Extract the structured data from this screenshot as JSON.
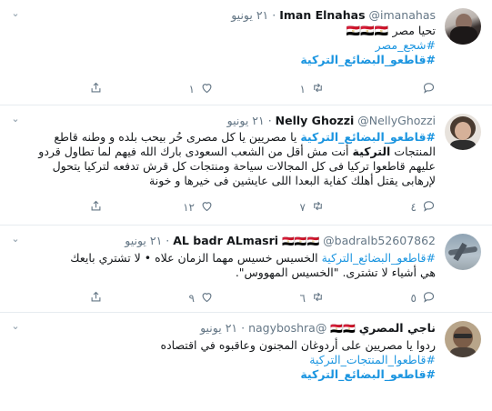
{
  "tweets": [
    {
      "name": "Iman Elnahas",
      "handle": "@imanahas",
      "time": "٢١ يونيو",
      "lines": [
        {
          "segments": [
            {
              "text": "تحيا مصر ",
              "style": "plain"
            },
            {
              "text": "🇪🇬🇪🇬🇪🇬",
              "style": "flags"
            }
          ]
        },
        {
          "segments": [
            {
              "text": "#شجع_مصر",
              "style": "tag"
            }
          ]
        },
        {
          "segments": [
            {
              "text": "#قاطعو_البضائع_التركية",
              "style": "tag-strong"
            }
          ]
        }
      ],
      "counts": {
        "reply": "",
        "retweet": "١",
        "like": "١"
      }
    },
    {
      "name": "Nelly Ghozzi",
      "handle": "@NellyGhozzi",
      "time": "٢١ يونيو",
      "lines": [
        {
          "segments": [
            {
              "text": "#قاطعو_البضائع_التركية",
              "style": "tag-strong"
            },
            {
              "text": " يا مصريين يا كل مصرى حُر  بيحب بلده و وطنه قاطع",
              "style": "plain"
            }
          ]
        },
        {
          "segments": [
            {
              "text": "المنتجات ",
              "style": "plain"
            },
            {
              "text": "التركية",
              "style": "bold"
            },
            {
              "text": " أنت مش أقل من الشعب السعودى بارك الله فيهم لما تطاول قردو",
              "style": "plain"
            }
          ]
        },
        {
          "segments": [
            {
              "text": "عليهم قاطعوا تركيا فى كل المجالات سياحة ومنتجات كل قرش تدفعه لتركيا يتحول",
              "style": "plain"
            }
          ]
        },
        {
          "segments": [
            {
              "text": "لإرهابى يقتل أهلك كفاية البعدا اللى عايشين فى خيرها و خونة",
              "style": "plain"
            }
          ]
        }
      ],
      "counts": {
        "reply": "٤",
        "retweet": "٧",
        "like": "١٢"
      }
    },
    {
      "name": "AL badr ALmasri",
      "name_flags": "🇪🇬🇪🇬🇪🇬",
      "handle": "@badralb52607862",
      "time": "٢١ يونيو",
      "lines": [
        {
          "segments": [
            {
              "text": "#قاطعو_البضائع_التركية",
              "style": "tag"
            },
            {
              "text": " الخسيس خسيس مهما الزمان علاه • لا تشتري بايعك",
              "style": "plain"
            }
          ]
        },
        {
          "segments": [
            {
              "text": "هي أشياء لا تشترى.  \"الخسيس المهووس\".",
              "style": "plain"
            }
          ]
        }
      ],
      "counts": {
        "reply": "٥",
        "retweet": "٦",
        "like": "٩"
      }
    },
    {
      "name": "ناجي المصري",
      "name_flags": "🇪🇬🇪🇬",
      "handle": "@nagyboshra",
      "time": "٢١ يونيو",
      "lines": [
        {
          "segments": [
            {
              "text": "ردوا يا مصريين على أردوغان المجنون وعاقبوه في اقتصاده",
              "style": "plain"
            }
          ]
        },
        {
          "segments": [
            {
              "text": "#قاطعوا_المنتجات_التركية",
              "style": "tag"
            }
          ]
        },
        {
          "segments": [
            {
              "text": "#قاطعو_البضائع_التركية",
              "style": "tag-strong"
            }
          ]
        }
      ],
      "counts": {
        "reply": "",
        "retweet": "",
        "like": ""
      }
    }
  ]
}
